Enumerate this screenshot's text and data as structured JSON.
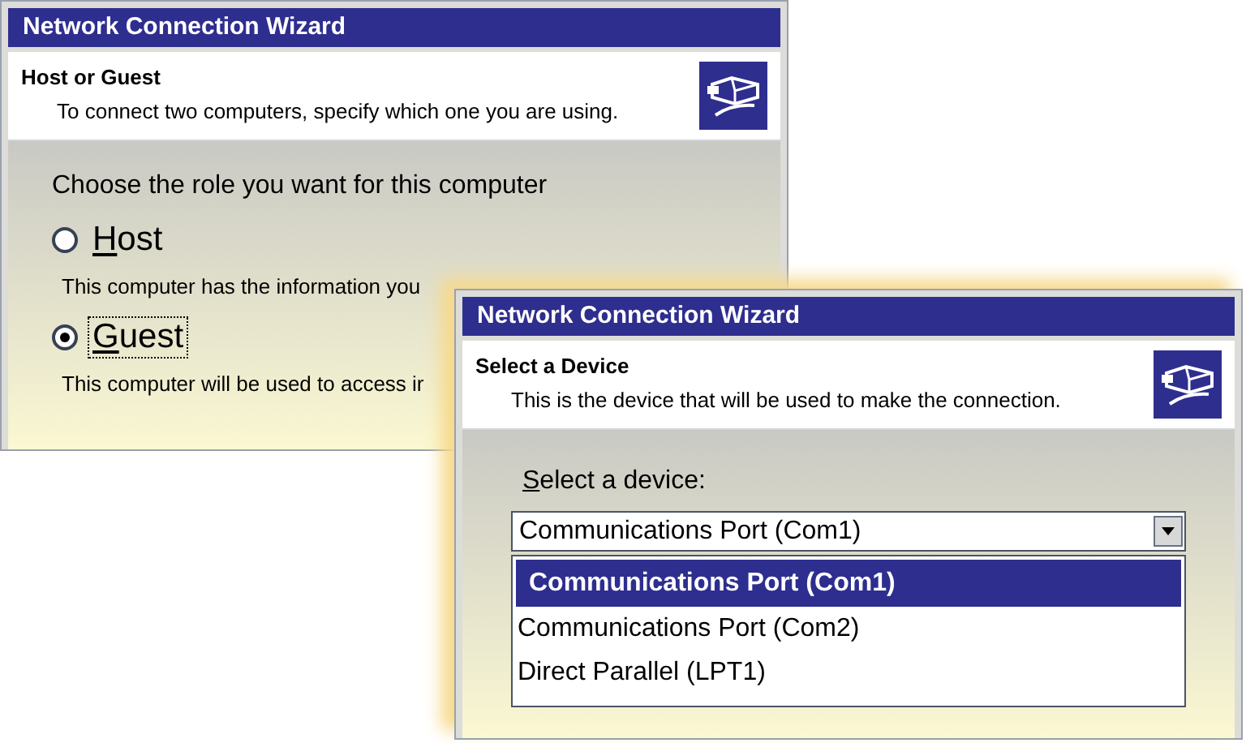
{
  "host_guest_window": {
    "title": "Network Connection Wizard",
    "header": {
      "title": "Host or Guest",
      "subtitle": "To connect two computers, specify which one you are using."
    },
    "prompt": "Choose the role you want for this computer",
    "roles": [
      {
        "label": "Host",
        "underline_first": true,
        "selected": false,
        "focused": false,
        "description": "This computer has the information you"
      },
      {
        "label": "Guest",
        "underline_first": true,
        "selected": true,
        "focused": true,
        "description": "This computer will be used to access ir"
      }
    ]
  },
  "device_window": {
    "title": "Network Connection Wizard",
    "header": {
      "title": "Select a Device",
      "subtitle": "This is the device that will be used to make the connection."
    },
    "field_label": {
      "text": "Select a device:",
      "underline_first": true
    },
    "combo_value": "Communications Port (Com1)",
    "expanded": true,
    "options": [
      {
        "label": "Communications Port (Com1)",
        "selected": true
      },
      {
        "label": "Communications Port (Com2)",
        "selected": false
      },
      {
        "label": "Direct Parallel (LPT1)",
        "selected": false
      }
    ]
  }
}
